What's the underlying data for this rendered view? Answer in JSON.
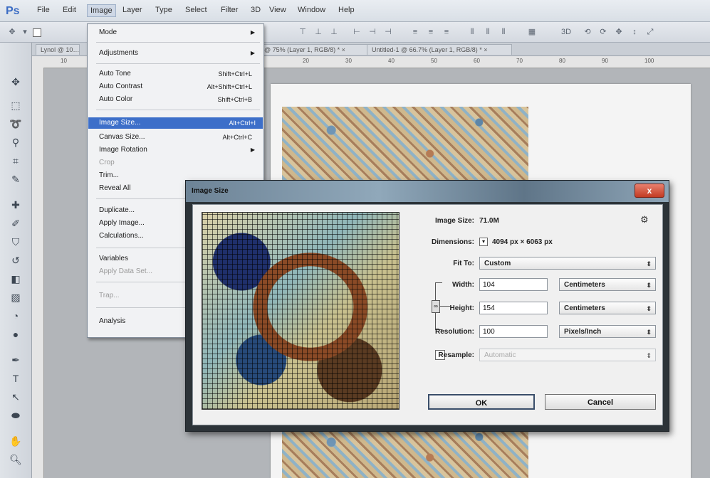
{
  "app": {
    "logo": "Ps",
    "menu": [
      "File",
      "Edit",
      "Image",
      "Layer",
      "Type",
      "Select",
      "Filter",
      "3D",
      "View",
      "Window",
      "Help"
    ],
    "active_menu": "Image"
  },
  "options_bar": {
    "tool_icons": [
      "move-tool-icon",
      "auto-select-checkbox",
      "align-icons"
    ]
  },
  "tabs": [
    {
      "label": "Lynol @ 10…"
    },
    {
      "label": "…at @ 75% (Layer 1, RGB/8) *  ×"
    },
    {
      "label": "Untitled-1 @ 66.7% (Layer 1, RGB/8) *  ×"
    }
  ],
  "ruler": {
    "h_ticks": [
      "10",
      "20",
      "30",
      "40",
      "50",
      "60",
      "70",
      "80",
      "90",
      "100"
    ]
  },
  "image_menu": {
    "items": [
      {
        "label": "Mode",
        "shortcut": "",
        "submenu": true,
        "disabled": false
      },
      {
        "label": "Adjustments",
        "shortcut": "",
        "submenu": true,
        "disabled": false
      },
      {
        "label": "Auto Tone",
        "shortcut": "Shift+Ctrl+L",
        "submenu": false,
        "disabled": false
      },
      {
        "label": "Auto Contrast",
        "shortcut": "Alt+Shift+Ctrl+L",
        "submenu": false,
        "disabled": false
      },
      {
        "label": "Auto Color",
        "shortcut": "Shift+Ctrl+B",
        "submenu": false,
        "disabled": false
      },
      {
        "label": "Image Size...",
        "shortcut": "Alt+Ctrl+I",
        "submenu": false,
        "disabled": false,
        "highlighted": true
      },
      {
        "label": "Canvas Size...",
        "shortcut": "Alt+Ctrl+C",
        "submenu": false,
        "disabled": false
      },
      {
        "label": "Image Rotation",
        "shortcut": "",
        "submenu": true,
        "disabled": false
      },
      {
        "label": "Crop",
        "shortcut": "",
        "submenu": false,
        "disabled": true
      },
      {
        "label": "Trim...",
        "shortcut": "",
        "submenu": false,
        "disabled": false
      },
      {
        "label": "Reveal All",
        "shortcut": "",
        "submenu": false,
        "disabled": false
      },
      {
        "label": "Duplicate...",
        "shortcut": "",
        "submenu": false,
        "disabled": false
      },
      {
        "label": "Apply Image...",
        "shortcut": "",
        "submenu": false,
        "disabled": false
      },
      {
        "label": "Calculations...",
        "shortcut": "",
        "submenu": false,
        "disabled": false
      },
      {
        "label": "Variables",
        "shortcut": "",
        "submenu": true,
        "disabled": false
      },
      {
        "label": "Apply Data Set...",
        "shortcut": "",
        "submenu": false,
        "disabled": true
      },
      {
        "label": "Trap...",
        "shortcut": "",
        "submenu": false,
        "disabled": true
      },
      {
        "label": "Analysis",
        "shortcut": "",
        "submenu": true,
        "disabled": false
      }
    ]
  },
  "dialog": {
    "title": "Image Size",
    "close": "x",
    "image_size_label": "Image Size:",
    "image_size_value": "71.0M",
    "dimensions_label": "Dimensions:",
    "dimensions_value": "4094 px  ×  6063 px",
    "fit_to_label": "Fit To:",
    "fit_to_value": "Custom",
    "width_label": "Width:",
    "width_value": "104",
    "width_unit": "Centimeters",
    "height_label": "Height:",
    "height_value": "154",
    "height_unit": "Centimeters",
    "resolution_label": "Resolution:",
    "resolution_value": "100",
    "resolution_unit": "Pixels/Inch",
    "resample_label": "Resample:",
    "resample_value": "Automatic",
    "ok_label": "OK",
    "cancel_label": "Cancel"
  }
}
